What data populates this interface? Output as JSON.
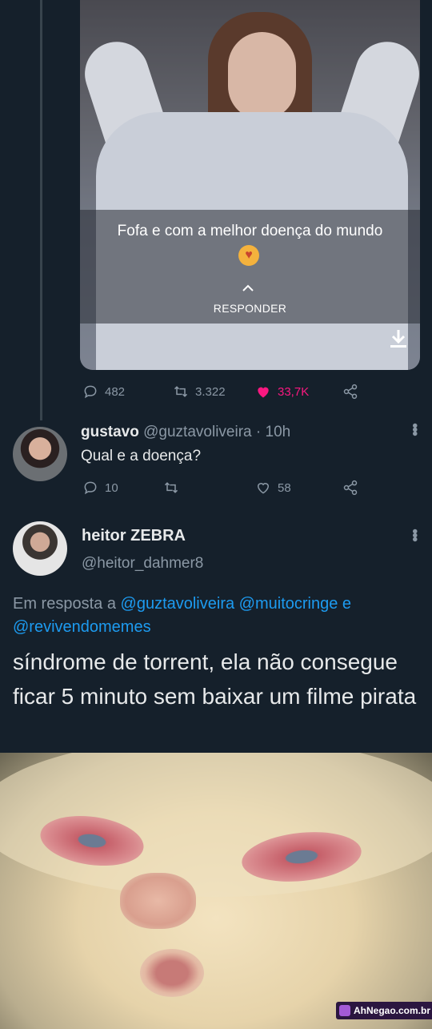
{
  "tweet_media": {
    "caption": "Fofa e com a melhor doença do mundo",
    "emoji_icon": "smiling-face-with-hearts",
    "reply_label": "RESPONDER"
  },
  "tweet_actions": {
    "replies": "482",
    "retweets": "3.322",
    "likes": "33,7K"
  },
  "reply1": {
    "name": "gustavo",
    "handle": "@guztavoliveira",
    "separator": "·",
    "time": "10h",
    "text": "Qual e a doença?",
    "replies": "10",
    "likes": "58"
  },
  "reply2": {
    "name": "heitor ZEBRA",
    "handle": "@heitor_dahmer8",
    "reply_prefix": "Em resposta a",
    "mention1": "@guztavoliveira",
    "mention2": "@muitocringe",
    "conj": "e",
    "mention3": "@revivendomemes",
    "text": "síndrome de torrent, ela não consegue ficar 5 minuto sem baixar um filme pirata"
  },
  "watermark": {
    "text": "AhNegao.com.br"
  },
  "colors": {
    "background": "#15202b",
    "link": "#1d9bf0",
    "like": "#f91880",
    "muted": "#8b98a5"
  }
}
